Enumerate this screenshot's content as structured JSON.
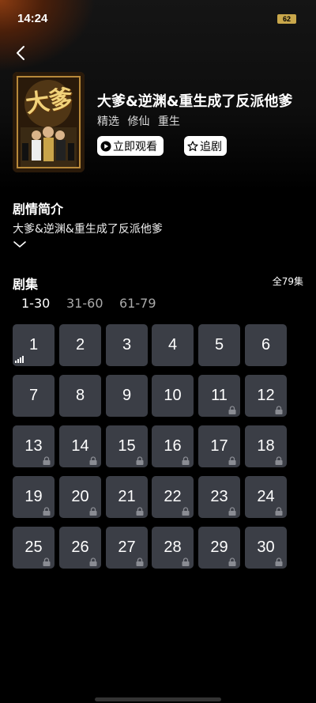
{
  "status_bar": {
    "time": "14:24",
    "battery": "62"
  },
  "drama": {
    "title": "大爹&逆渊&重生成了反派他爹",
    "tags": [
      "精选",
      "修仙",
      "重生"
    ],
    "watch_label": "立即观看",
    "follow_label": "追剧",
    "poster_text": "大爹"
  },
  "synopsis": {
    "heading": "剧情简介",
    "text": "大爹&逆渊&重生成了反派他爹"
  },
  "episodes": {
    "heading": "剧集",
    "total": "全79集",
    "ranges": [
      "1-30",
      "31-60",
      "61-79"
    ],
    "active_range": "1-30",
    "current": "1",
    "items": [
      {
        "n": "1",
        "locked": false
      },
      {
        "n": "2",
        "locked": false
      },
      {
        "n": "3",
        "locked": false
      },
      {
        "n": "4",
        "locked": false
      },
      {
        "n": "5",
        "locked": false
      },
      {
        "n": "6",
        "locked": false
      },
      {
        "n": "7",
        "locked": false
      },
      {
        "n": "8",
        "locked": false
      },
      {
        "n": "9",
        "locked": false
      },
      {
        "n": "10",
        "locked": false
      },
      {
        "n": "11",
        "locked": true
      },
      {
        "n": "12",
        "locked": true
      },
      {
        "n": "13",
        "locked": true
      },
      {
        "n": "14",
        "locked": true
      },
      {
        "n": "15",
        "locked": true
      },
      {
        "n": "16",
        "locked": true
      },
      {
        "n": "17",
        "locked": true
      },
      {
        "n": "18",
        "locked": true
      },
      {
        "n": "19",
        "locked": true
      },
      {
        "n": "20",
        "locked": true
      },
      {
        "n": "21",
        "locked": true
      },
      {
        "n": "22",
        "locked": true
      },
      {
        "n": "23",
        "locked": true
      },
      {
        "n": "24",
        "locked": true
      },
      {
        "n": "25",
        "locked": true
      },
      {
        "n": "26",
        "locked": true
      },
      {
        "n": "27",
        "locked": true
      },
      {
        "n": "28",
        "locked": true
      },
      {
        "n": "29",
        "locked": true
      },
      {
        "n": "30",
        "locked": true
      }
    ]
  },
  "colors": {
    "tile": "#3b3e46",
    "battery": "#c9a74b",
    "accent_glow": "#8a3c12"
  }
}
